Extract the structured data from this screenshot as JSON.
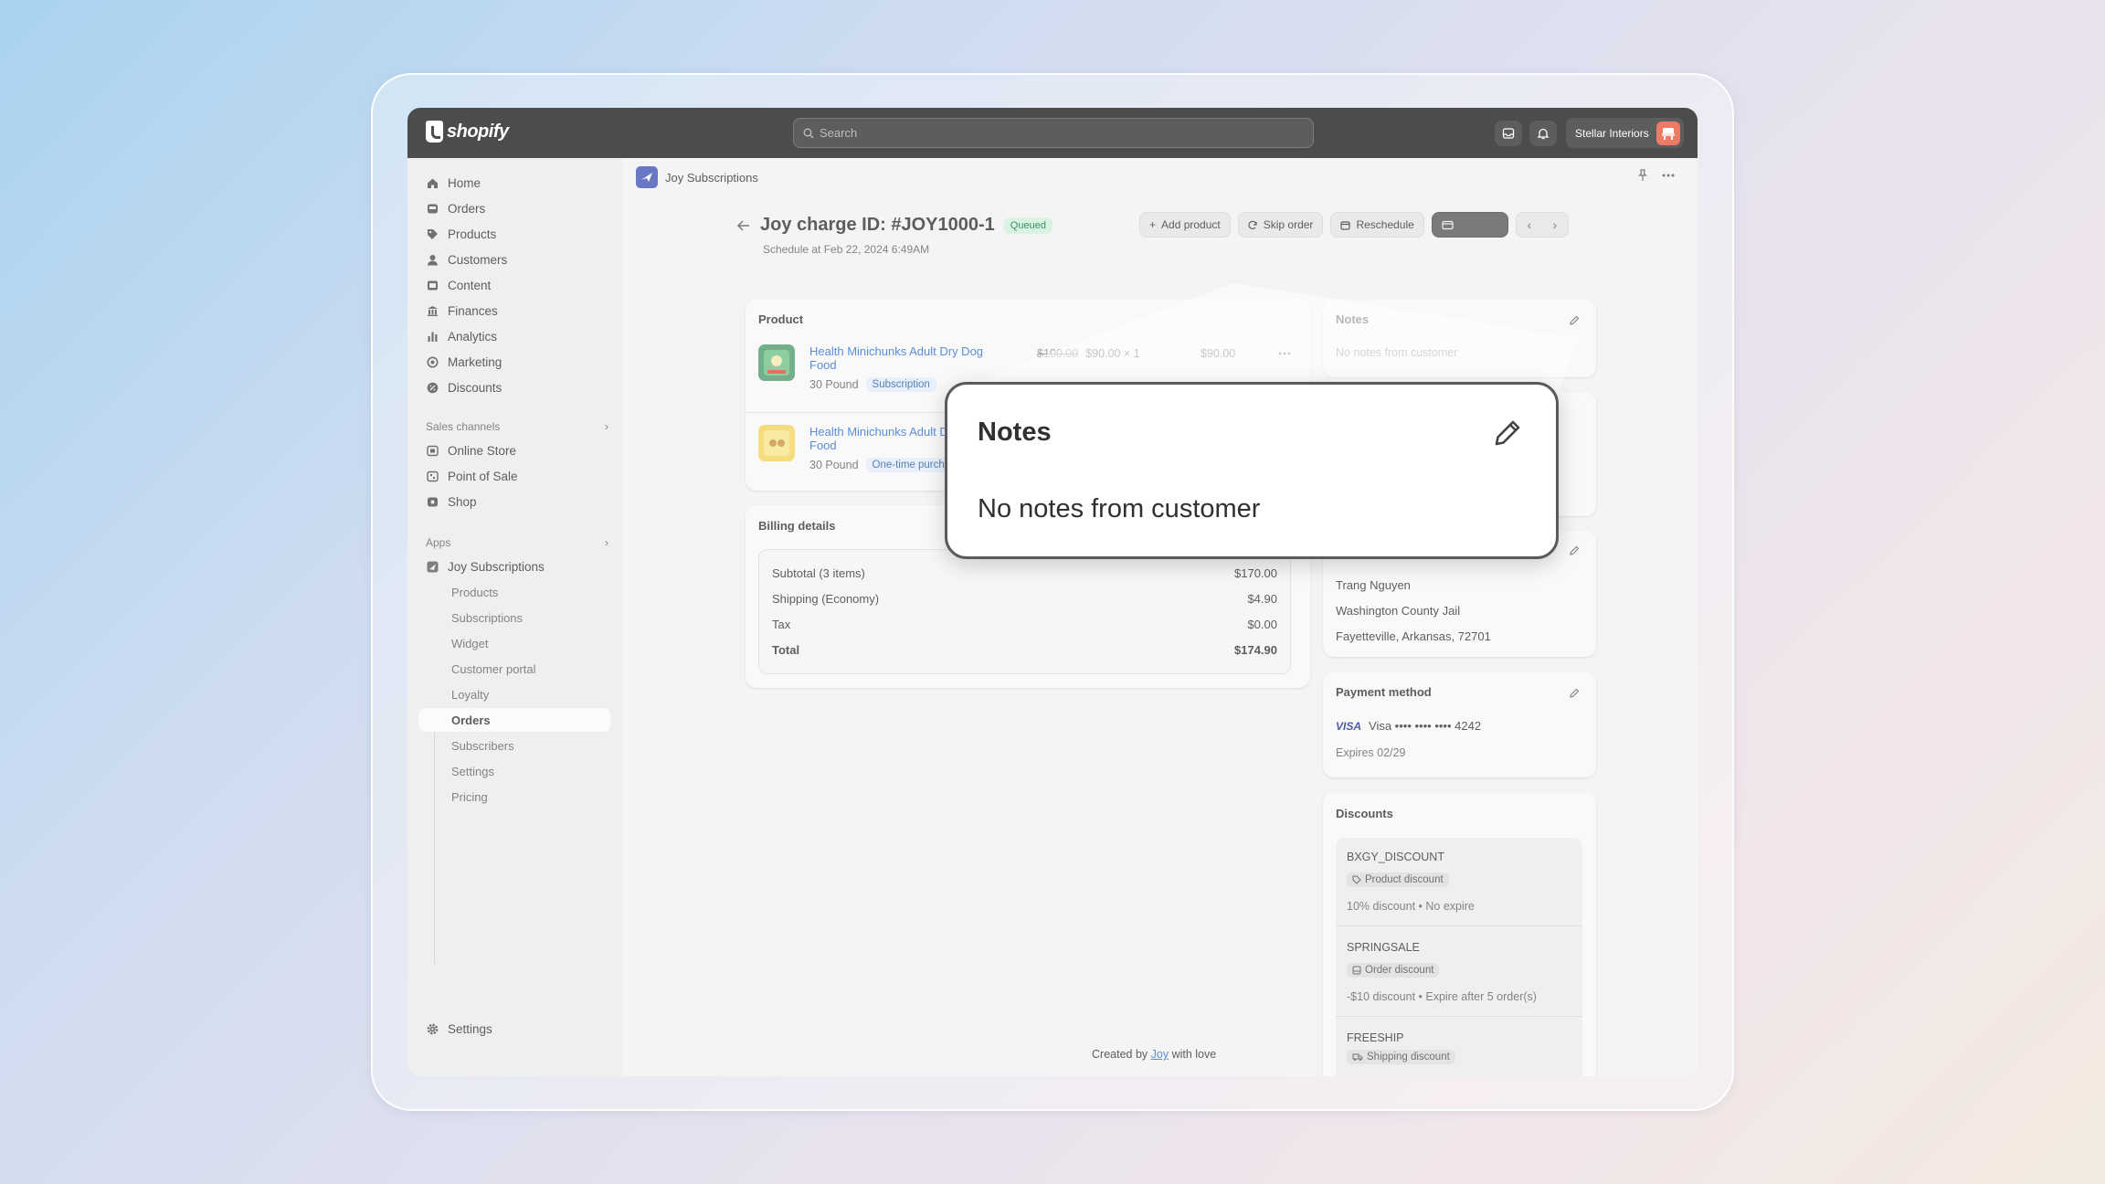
{
  "topbar": {
    "brand": "shopify",
    "search_placeholder": "Search",
    "store_name": "Stellar Interiors"
  },
  "sidebar": {
    "items": [
      {
        "label": "Home",
        "icon": "home-icon"
      },
      {
        "label": "Orders",
        "icon": "inbox-icon"
      },
      {
        "label": "Products",
        "icon": "tag-icon"
      },
      {
        "label": "Customers",
        "icon": "person-icon"
      },
      {
        "label": "Content",
        "icon": "image-icon"
      },
      {
        "label": "Finances",
        "icon": "bank-icon"
      },
      {
        "label": "Analytics",
        "icon": "bar-chart-icon"
      },
      {
        "label": "Marketing",
        "icon": "target-icon"
      },
      {
        "label": "Discounts",
        "icon": "gear-discount-icon"
      }
    ],
    "sales_channels_heading": "Sales channels",
    "channels": [
      "Online Store",
      "Point of Sale",
      "Shop"
    ],
    "apps_heading": "Apps",
    "app_name": "Joy Subscriptions",
    "app_subitems": [
      "Products",
      "Subscriptions",
      "Widget",
      "Customer portal",
      "Loyalty",
      "Orders",
      "Subscribers",
      "Settings",
      "Pricing"
    ],
    "active_subitem": "Orders",
    "settings_label": "Settings"
  },
  "app_header": {
    "app_name": "Joy Subscriptions"
  },
  "page": {
    "title": "Joy charge ID: #JOY1000-1",
    "status": "Queued",
    "schedule": "Schedule at Feb 22, 2024 6:49AM",
    "actions": {
      "add_product": "Add product",
      "skip_order": "Skip order",
      "reschedule": "Reschedule"
    }
  },
  "product_card": {
    "title": "Product",
    "items": [
      {
        "name": "Health Minichunks Adult Dry Dog Food",
        "variant": "30 Pound",
        "type": "Subscription",
        "compare_price": "$100.00",
        "unit_price": "$90.00 × 1",
        "line_total": "$90.00"
      },
      {
        "name": "Health Minichunks Adult Dry Dog Food",
        "name_visible": "Health Minichunks Adult D",
        "name_line2": "Food",
        "variant": "30 Pound",
        "type": "One-time purch"
      }
    ]
  },
  "billing": {
    "title": "Billing details",
    "rows": [
      {
        "label": "Subtotal (3 items)",
        "value": "$170.00"
      },
      {
        "label": "Shipping (Economy)",
        "value": "$4.90"
      },
      {
        "label": "Tax",
        "value": "$0.00"
      },
      {
        "label": "Total",
        "value": "$174.90"
      }
    ]
  },
  "notes": {
    "title": "Notes",
    "body": "No notes from customer"
  },
  "shipping_address": {
    "lines": [
      "Trang Nguyen",
      "Washington County Jail",
      "Fayetteville, Arkansas, 72701"
    ]
  },
  "payment": {
    "title": "Payment method",
    "brand": "VISA",
    "card": "Visa •••• •••• •••• 4242",
    "expires": "Expires 02/29"
  },
  "discounts": {
    "title": "Discounts",
    "items": [
      {
        "code": "BXGY_DISCOUNT",
        "type": "Product discount",
        "desc": "10% discount • No expire"
      },
      {
        "code": "SPRINGSALE",
        "type": "Order discount",
        "desc": "-$10 discount • Expire after 5 order(s)"
      },
      {
        "code": "FREESHIP",
        "type": "Shipping discount",
        "desc": ""
      }
    ]
  },
  "footer": {
    "prefix": "Created by",
    "link": "Joy",
    "suffix": "with love"
  },
  "zoom_callout": {
    "title": "Notes",
    "body": "No notes from customer"
  },
  "colors": {
    "accent_link": "#2c6ecb",
    "topbar_bg": "#1a1a1a",
    "queued_bg": "#cdf0d8"
  }
}
